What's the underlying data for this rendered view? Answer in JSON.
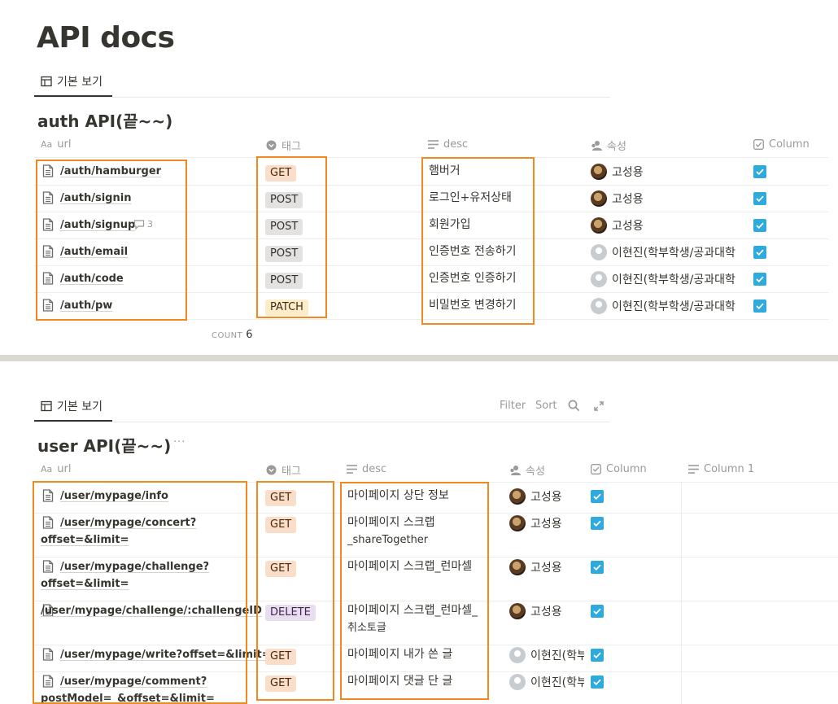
{
  "page": {
    "title": "API docs"
  },
  "view_tab": {
    "label": "기본 보기"
  },
  "toolbar": {
    "filter": "Filter",
    "sort": "Sort"
  },
  "auth_db": {
    "title": "auth API(끝~~)",
    "columns": {
      "url": "url",
      "tag": "태그",
      "desc": "desc",
      "owner": "속성",
      "column": "Column"
    },
    "rows": [
      {
        "url": "/auth/hamburger",
        "tag": "GET",
        "desc": "햄버거",
        "owner": "고성용",
        "checked": true
      },
      {
        "url": "/auth/signin",
        "tag": "POST",
        "desc": "로그인+유저상태",
        "owner": "고성용",
        "checked": true
      },
      {
        "url": "/auth/signup",
        "tag": "POST",
        "desc": "회원가입",
        "owner": "고성용",
        "checked": true,
        "comments": "3"
      },
      {
        "url": "/auth/email",
        "tag": "POST",
        "desc": "인증번호 전송하기",
        "owner": "이현진(학부학생/공과대학",
        "checked": true
      },
      {
        "url": "/auth/code",
        "tag": "POST",
        "desc": "인증번호 인증하기",
        "owner": "이현진(학부학생/공과대학",
        "checked": true
      },
      {
        "url": "/auth/pw",
        "tag": "PATCH",
        "desc": "비밀번호 변경하기",
        "owner": "이현진(학부학생/공과대학",
        "checked": true
      }
    ],
    "count_label": "COUNT",
    "count_value": "6"
  },
  "user_db": {
    "title": "user API(끝~~)",
    "more": "···",
    "columns": {
      "url": "url",
      "tag": "태그",
      "desc": "desc",
      "owner": "속성",
      "column": "Column",
      "column1": "Column 1"
    },
    "rows": [
      {
        "url_a": "/user/mypage/info",
        "url_b": "",
        "tag": "GET",
        "desc_a": "마이페이지 상단 정보",
        "desc_b": "",
        "owner": "고성용",
        "checked": true
      },
      {
        "url_a": "/user/mypage/concert?",
        "url_b": "offset=&limit=",
        "tag": "GET",
        "desc_a": "마이페이지 스크랩",
        "desc_b": "_shareTogether",
        "owner": "고성용",
        "checked": true
      },
      {
        "url_a": "/user/mypage/challenge?",
        "url_b": "offset=&limit=",
        "tag": "GET",
        "desc_a": "마이페이지 스크랩_런마셀",
        "desc_b": "",
        "owner": "고성용",
        "checked": true
      },
      {
        "url_a": "",
        "url_b": "/user/mypage/challenge/:challengeID",
        "tag": "DELETE",
        "desc_a": "마이페이지 스크랩_런마셀_",
        "desc_b": "취소토글",
        "owner": "고성용",
        "checked": true
      },
      {
        "url_a": "/user/mypage/write?offset=&limit=",
        "url_b": "",
        "tag": "GET",
        "desc_a": "마이페이지 내가 쓴 글",
        "desc_b": "",
        "owner": "이현진(학부",
        "checked": true
      },
      {
        "url_a": "/user/mypage/comment?",
        "url_b": "postModel=_&offset=&limit=",
        "tag": "GET",
        "desc_a": "마이페이지 댓글 단 글",
        "desc_b": "",
        "owner": "이현진(학부",
        "checked": true
      }
    ]
  },
  "colors": {
    "highlight": "#f0891e",
    "checkbox": "#2eaadc",
    "get_tag": "#fadec9",
    "post_tag": "#e3e2e0",
    "patch_tag": "#fdecc8",
    "delete_tag": "#e8deee"
  }
}
